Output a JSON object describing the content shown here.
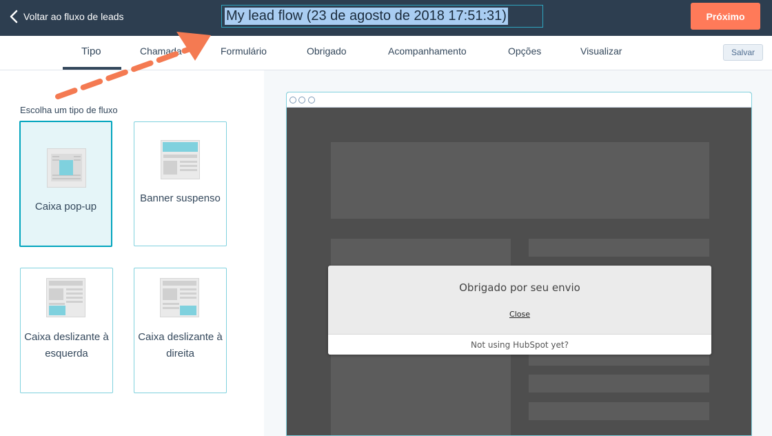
{
  "header": {
    "back_label": "Voltar ao fluxo de leads",
    "title": "My lead flow (23 de agosto de 2018 17:51:31)",
    "next_label": "Próximo"
  },
  "tabs": [
    {
      "label": "Tipo",
      "active": true
    },
    {
      "label": "Chamada"
    },
    {
      "label": "Formulário"
    },
    {
      "label": "Obrigado"
    },
    {
      "label": "Acompanhamento"
    },
    {
      "label": "Opções"
    },
    {
      "label": "Visualizar"
    }
  ],
  "save_label": "Salvar",
  "flow_types": {
    "title": "Escolha um tipo de fluxo",
    "options": [
      {
        "label": "Caixa pop-up",
        "selected": true,
        "icon": "popup-box-icon"
      },
      {
        "label": "Banner suspenso",
        "icon": "dropdown-banner-icon"
      },
      {
        "label": "Caixa deslizante à esquerda",
        "icon": "slide-in-left-icon"
      },
      {
        "label": "Caixa deslizante à direita",
        "icon": "slide-in-right-icon"
      }
    ]
  },
  "preview": {
    "message": "Obrigado por seu envio",
    "close_label": "Close",
    "footer": "Not using HubSpot yet?"
  },
  "colors": {
    "topbar": "#2d3e50",
    "accent": "#ff7a59",
    "teal": "#00a4bd",
    "thumb_highlight": "#7fd1de",
    "annotation_arrow": "#f47a52"
  }
}
